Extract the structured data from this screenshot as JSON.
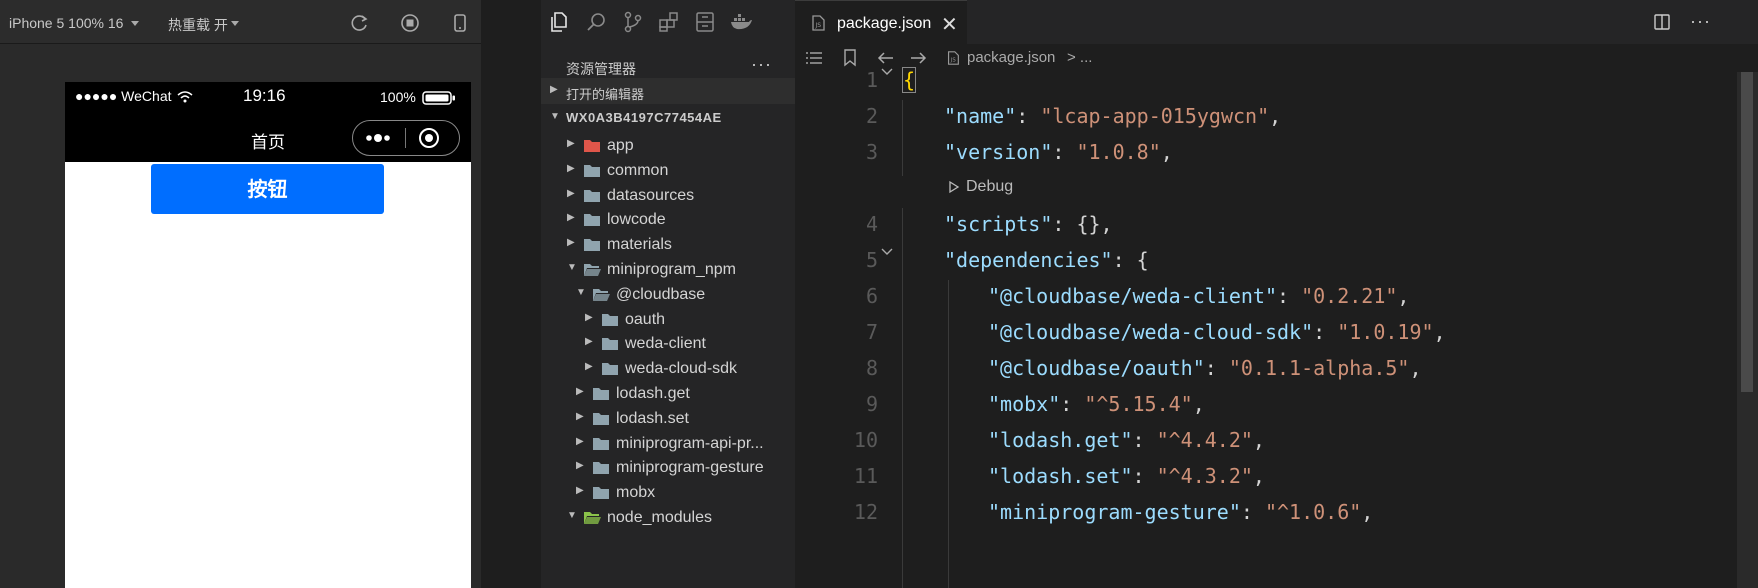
{
  "simulator": {
    "device": "iPhone 5 100% 16",
    "hot_reload": "热重载 开",
    "status": {
      "signal": "●●●●● WeChat",
      "time": "19:16",
      "battery": "100%"
    },
    "page_title": "首页",
    "button_label": "按钮"
  },
  "explorer": {
    "title": "资源管理器",
    "more": "···",
    "open_editors": "打开的编辑器",
    "workspace": "WX0A3B4197C77454AE",
    "tree": [
      {
        "label": "app",
        "expanded": false
      },
      {
        "label": "common",
        "expanded": false
      },
      {
        "label": "datasources",
        "expanded": false
      },
      {
        "label": "lowcode",
        "expanded": false
      },
      {
        "label": "materials",
        "expanded": false
      },
      {
        "label": "miniprogram_npm",
        "expanded": true
      },
      {
        "label": "@cloudbase",
        "expanded": true
      },
      {
        "label": "oauth",
        "expanded": false
      },
      {
        "label": "weda-client",
        "expanded": false
      },
      {
        "label": "weda-cloud-sdk",
        "expanded": false
      },
      {
        "label": "lodash.get",
        "expanded": false
      },
      {
        "label": "lodash.set",
        "expanded": false
      },
      {
        "label": "miniprogram-api-pr...",
        "expanded": false
      },
      {
        "label": "miniprogram-gesture",
        "expanded": false
      },
      {
        "label": "mobx",
        "expanded": false
      },
      {
        "label": "node_modules",
        "expanded": true
      }
    ]
  },
  "editor": {
    "tab_label": "package.json",
    "tab_close": "✕",
    "breadcrumb_file": "package.json",
    "breadcrumb_rest": "> ...",
    "debug_label": "Debug",
    "lines": [
      {
        "n": "1",
        "k": "",
        "v": "",
        "pre": "{",
        "post": ""
      },
      {
        "n": "2",
        "k": "\"name\"",
        "v": "\"lcap-app-015ygwcn\"",
        "pre": "",
        "post": ","
      },
      {
        "n": "3",
        "k": "\"version\"",
        "v": "\"1.0.8\"",
        "pre": "",
        "post": ","
      },
      {
        "n": "4",
        "k": "\"scripts\"",
        "v": "",
        "pre": "",
        "post": ": {},"
      },
      {
        "n": "5",
        "k": "\"dependencies\"",
        "v": "",
        "pre": "",
        "post": ": {"
      },
      {
        "n": "6",
        "k": "\"@cloudbase/weda-client\"",
        "v": "\"0.2.21\"",
        "pre": "",
        "post": ","
      },
      {
        "n": "7",
        "k": "\"@cloudbase/weda-cloud-sdk\"",
        "v": "\"1.0.19\"",
        "pre": "",
        "post": ","
      },
      {
        "n": "8",
        "k": "\"@cloudbase/oauth\"",
        "v": "\"0.1.1-alpha.5\"",
        "pre": "",
        "post": ","
      },
      {
        "n": "9",
        "k": "\"mobx\"",
        "v": "\"^5.15.4\"",
        "pre": "",
        "post": ","
      },
      {
        "n": "10",
        "k": "\"lodash.get\"",
        "v": "\"^4.4.2\"",
        "pre": "",
        "post": ","
      },
      {
        "n": "11",
        "k": "\"lodash.set\"",
        "v": "\"^4.3.2\"",
        "pre": "",
        "post": ","
      },
      {
        "n": "12",
        "k": "\"miniprogram-gesture\"",
        "v": "\"^1.0.6\"",
        "pre": "",
        "post": ","
      }
    ]
  },
  "colors": {
    "accent_button": "#006eff",
    "json_key": "#9cdcfe",
    "json_string": "#ce9178",
    "brace_highlight": "#ffd700"
  }
}
